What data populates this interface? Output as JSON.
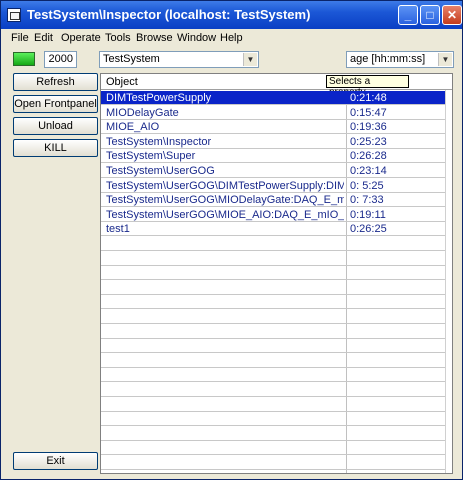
{
  "window": {
    "title": "TestSystem\\Inspector (localhost: TestSystem)",
    "minimize": "_",
    "maximize": "□",
    "close": "✕"
  },
  "menu": [
    "File",
    "Edit",
    "Operate",
    "Tools",
    "Browse",
    "Window",
    "Help"
  ],
  "toolbar": {
    "interval": "2000",
    "system": "TestSystem",
    "property": "age [hh:mm:ss]"
  },
  "buttons": {
    "refresh": "Refresh",
    "open_frontpanel": "Open Frontpanel",
    "unload": "Unload",
    "kill": "KILL",
    "exit": "Exit"
  },
  "table": {
    "header_object": "Object",
    "header_property": "Selects a property",
    "rows": [
      {
        "object": "DIMTestPowerSupply",
        "age": "0:21:48"
      },
      {
        "object": "MIODelayGate",
        "age": "0:15:47"
      },
      {
        "object": "MIOE_AIO",
        "age": "0:19:36"
      },
      {
        "object": "TestSystem\\Inspector",
        "age": "0:25:23"
      },
      {
        "object": "TestSystem\\Super",
        "age": "0:26:28"
      },
      {
        "object": "TestSystem\\UserGOG",
        "age": "0:23:14"
      },
      {
        "object": "TestSystem\\UserGOG\\DIMTestPowerSupply:DIMPowerS",
        "age": "0: 5:25"
      },
      {
        "object": "TestSystem\\UserGOG\\MIODelayGate:DAQ_E_mIO_Cnt",
        "age": "0: 7:33"
      },
      {
        "object": "TestSystem\\UserGOG\\MIOE_AIO:DAQ_E_mIO_AIOGUI",
        "age": "0:19:11"
      },
      {
        "object": "test1",
        "age": "0:26:25"
      }
    ]
  },
  "colors": {
    "selection": "#0a24c8",
    "row_text": "#1a2a8c",
    "led_on": "#2fd42f"
  }
}
